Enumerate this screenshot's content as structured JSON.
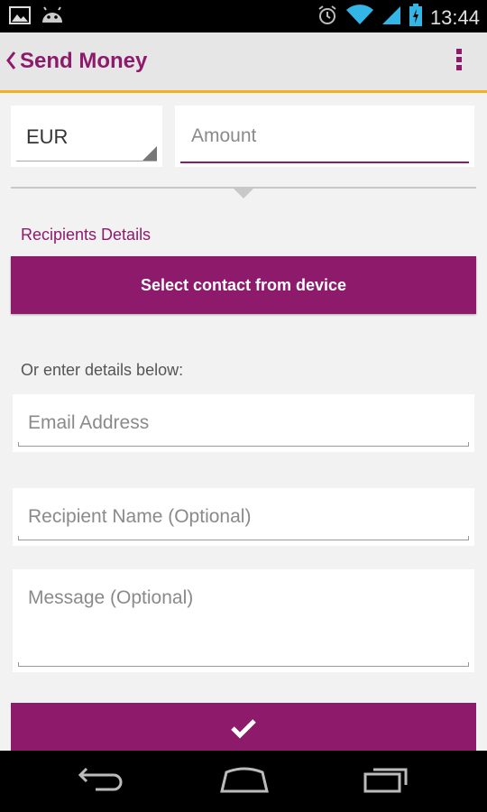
{
  "statusbar": {
    "time": "13:44"
  },
  "actionbar": {
    "title": "Send Money"
  },
  "form": {
    "currency": "EUR",
    "amount_placeholder": "Amount",
    "recipients_label": "Recipients Details",
    "select_contact_label": "Select contact from device",
    "or_label": "Or enter details below:",
    "email_placeholder": "Email Address",
    "name_placeholder": "Recipient Name (Optional)",
    "message_placeholder": "Message (Optional)"
  },
  "colors": {
    "brand": "#8e1a6c",
    "accent": "#f0b21e"
  },
  "icons": [
    "image-icon",
    "android-icon",
    "alarm-icon",
    "wifi-icon",
    "battery-icon",
    "back-chevron-icon",
    "overflow-menu-icon",
    "checkmark-icon",
    "back-icon",
    "home-icon",
    "recents-icon"
  ]
}
